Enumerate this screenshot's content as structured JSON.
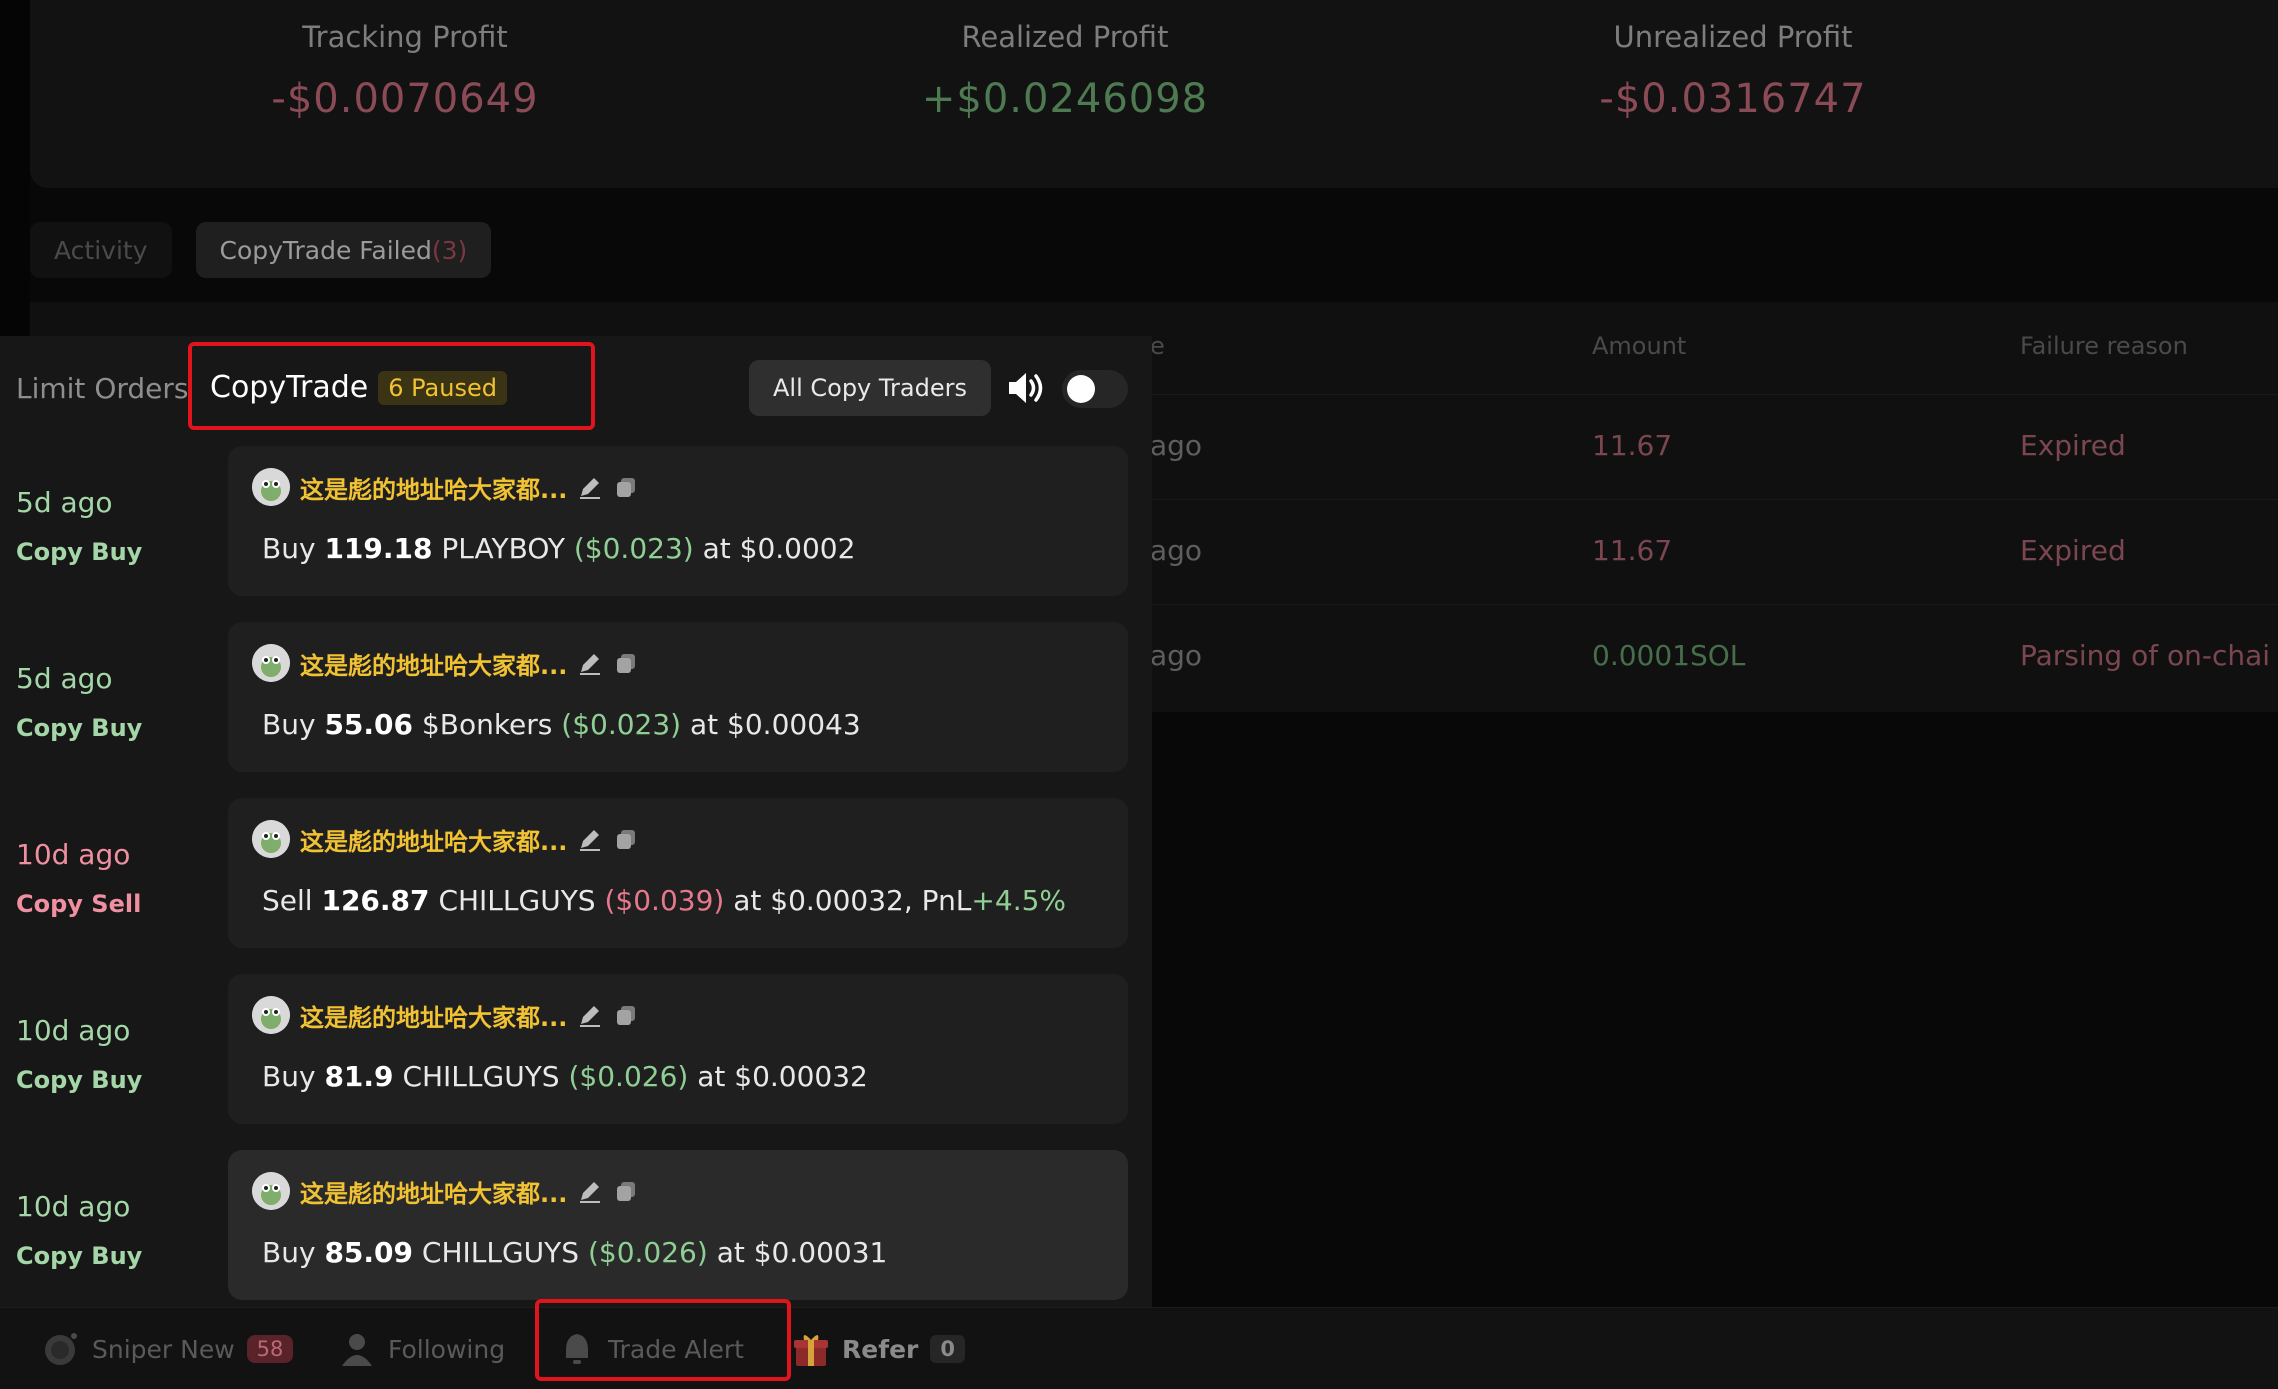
{
  "stats": [
    {
      "label": "Tracking Profit",
      "value": "-$0.0070649",
      "tone": "neg"
    },
    {
      "label": "Realized Profit",
      "value": "+$0.0246098",
      "tone": "pos"
    },
    {
      "label": "Unrealized Profit",
      "value": "-$0.0316747",
      "tone": "neg"
    }
  ],
  "bg_tabs": {
    "activity": "Activity",
    "copytrade_failed": "CopyTrade Failed",
    "copytrade_failed_count": "(3)"
  },
  "bg_table": {
    "col_time_fragment": "e",
    "col_amount": "Amount",
    "col_reason": "Failure reason",
    "rows": [
      {
        "ago": "ago",
        "amount": "11.67",
        "reason": "Expired"
      },
      {
        "ago": "ago",
        "amount": "11.67",
        "reason": "Expired"
      },
      {
        "ago": "ago",
        "amount": "0.0001SOL",
        "reason": "Parsing of on-chai"
      }
    ]
  },
  "panel": {
    "tab_limit": "Limit Orders",
    "tab_copytrade": "CopyTrade",
    "paused_badge": "6 Paused",
    "all_traders_button": "All Copy Traders",
    "sound_icon": "speaker-icon",
    "toggle_on": false
  },
  "feed": [
    {
      "time": "5d ago",
      "kind": "Copy Buy",
      "trader": "这是彪的地址哈大家都...",
      "verb": "Buy",
      "qty": "119.18",
      "token": "PLAYBOY",
      "usd": "($0.023)",
      "at": "at $0.0002",
      "pnl_label": "",
      "pnl": ""
    },
    {
      "time": "5d ago",
      "kind": "Copy Buy",
      "trader": "这是彪的地址哈大家都...",
      "verb": "Buy",
      "qty": "55.06",
      "token": "$Bonkers",
      "usd": "($0.023)",
      "at": "at $0.00043",
      "pnl_label": "",
      "pnl": ""
    },
    {
      "time": "10d ago",
      "kind": "Copy Sell",
      "trader": "这是彪的地址哈大家都...",
      "verb": "Sell",
      "qty": "126.87",
      "token": "CHILLGUYS",
      "usd": "($0.039)",
      "at": "at $0.00032,",
      "pnl_label": "PnL",
      "pnl": "+4.5%"
    },
    {
      "time": "10d ago",
      "kind": "Copy Buy",
      "trader": "这是彪的地址哈大家都...",
      "verb": "Buy",
      "qty": "81.9",
      "token": "CHILLGUYS",
      "usd": "($0.026)",
      "at": "at $0.00032",
      "pnl_label": "",
      "pnl": ""
    },
    {
      "time": "10d ago",
      "kind": "Copy Buy",
      "trader": "这是彪的地址哈大家都...",
      "verb": "Buy",
      "qty": "85.09",
      "token": "CHILLGUYS",
      "usd": "($0.026)",
      "at": "at $0.00031",
      "pnl_label": "",
      "pnl": ""
    }
  ],
  "bottom_nav": {
    "sniper_new": "Sniper New",
    "sniper_new_count": "58",
    "following": "Following",
    "trade_alert": "Trade Alert",
    "refer": "Refer",
    "refer_count": "0"
  },
  "colors": {
    "accent_yellow": "#f1c232",
    "buy_green": "#a5d6a7",
    "sell_pink": "#ef8fa0",
    "highlight_red": "#e0141c"
  }
}
